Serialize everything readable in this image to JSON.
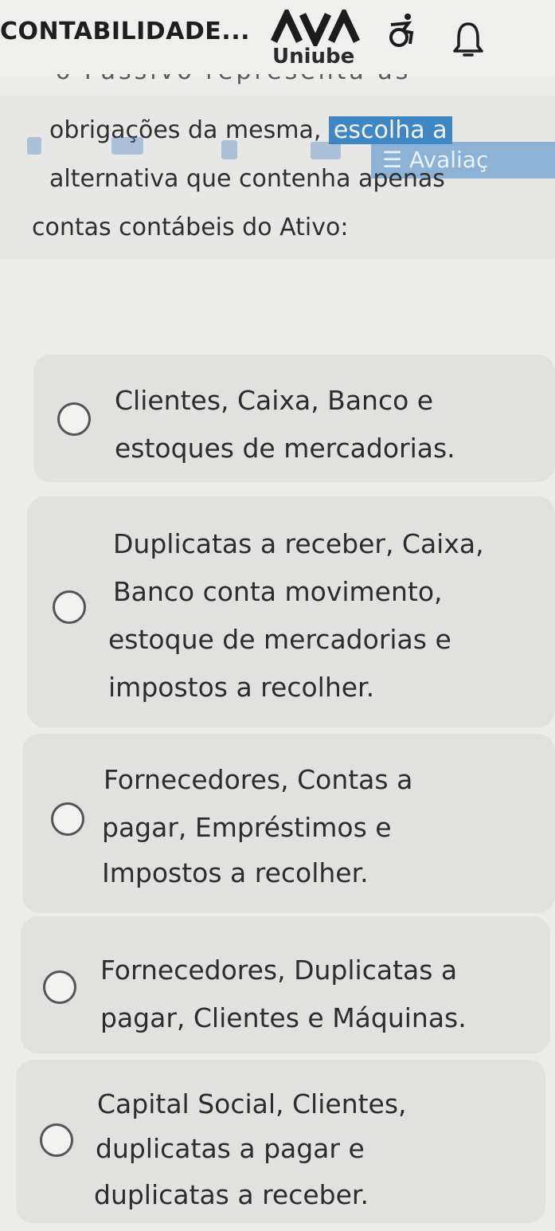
{
  "header": {
    "course_title": "CONTABILIDADE...",
    "logo_text": "Uniube",
    "icons": [
      "ava-logo",
      "accessibility-icon",
      "bell-icon"
    ]
  },
  "question": {
    "cut_line": "o Passivo representa as",
    "line1_plain": "obrigações da mesma, ",
    "line1_highlight": "escolha a",
    "line2": "alternativa que contenha apenas",
    "line3": "contas contábeis do Ativo:",
    "overlay_button": "☰ Avaliaç"
  },
  "options": [
    {
      "lines": [
        "Clientes, Caixa, Banco e",
        "estoques de mercadorias."
      ]
    },
    {
      "lines": [
        "Duplicatas a receber, Caixa,",
        "Banco conta movimento,",
        "estoque de mercadorias e",
        "impostos a recolher."
      ]
    },
    {
      "lines": [
        "Fornecedores, Contas a",
        "pagar, Empréstimos e",
        "Impostos a recolher."
      ]
    },
    {
      "lines": [
        "Fornecedores, Duplicatas a",
        "pagar, Clientes e Máquinas."
      ]
    },
    {
      "lines": [
        "Capital Social, Clientes,",
        "duplicatas a pagar e",
        "duplicatas a receber."
      ]
    }
  ],
  "colors": {
    "accent": "#3f86c4",
    "background": "#ececea",
    "option_bg": "#e1e1df"
  }
}
